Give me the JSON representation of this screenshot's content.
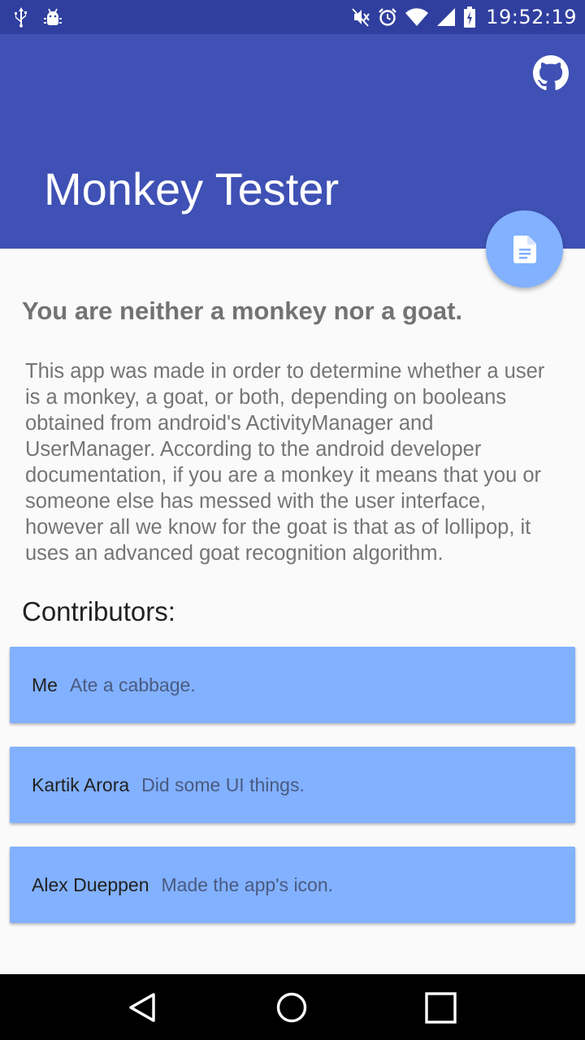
{
  "status_bar": {
    "time": "19:52:19",
    "icons": [
      "usb-icon",
      "android-debug-icon",
      "mute-icon",
      "alarm-icon",
      "wifi-icon",
      "signal-icon",
      "battery-icon"
    ]
  },
  "app_bar": {
    "title": "Monkey Tester",
    "action_icon": "github-icon",
    "color": "#3f51b5",
    "status_color": "#303f9f"
  },
  "fab": {
    "icon": "document-icon",
    "color": "#82b1ff"
  },
  "main": {
    "heading": "You are neither a monkey nor a goat.",
    "description": "This app was made in order to determine whether a user is a monkey, a goat, or both, depending on booleans obtained from android's ActivityManager and UserManager. According to the android developer documentation, if you are a monkey it means that you or someone else has messed with the user interface, however all we know for the goat is that as of lollipop, it uses an advanced goat recognition algorithm.",
    "contributors_title": "Contributors:",
    "contributors": [
      {
        "name": "Me",
        "contribution": "Ate a cabbage."
      },
      {
        "name": "Kartik Arora",
        "contribution": "Did some UI things."
      },
      {
        "name": "Alex Dueppen",
        "contribution": "Made the app's icon."
      }
    ],
    "card_color": "#82b1ff"
  },
  "nav_bar": {
    "icons": [
      "back-icon",
      "home-icon",
      "recents-icon"
    ]
  }
}
